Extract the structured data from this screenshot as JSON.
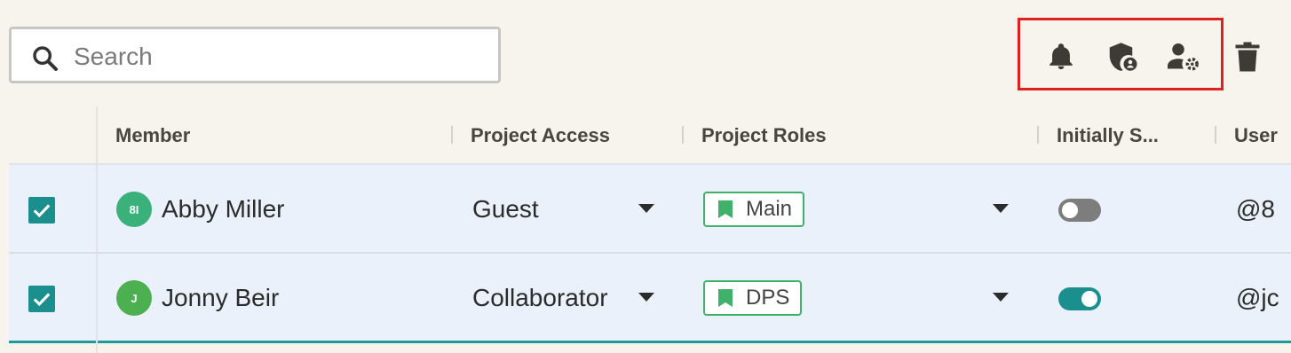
{
  "search": {
    "placeholder": "Search",
    "value": ""
  },
  "toolbar": {
    "icons": [
      "bell-icon",
      "shield-account-icon",
      "user-settings-icon",
      "trash-icon"
    ]
  },
  "table": {
    "headers": {
      "member": "Member",
      "project_access": "Project Access",
      "project_roles": "Project Roles",
      "initially_selected": "Initially S...",
      "user": "User"
    },
    "rows": [
      {
        "checked": true,
        "avatar_initials": "8I",
        "avatar_color": "#3ab07a",
        "name": "Abby Miller",
        "access": "Guest",
        "role": "Main",
        "toggle_on": false,
        "username": "@8"
      },
      {
        "checked": true,
        "avatar_initials": "J",
        "avatar_color": "#4cb050",
        "name": "Jonny Beir",
        "access": "Collaborator",
        "role": "DPS",
        "toggle_on": true,
        "username": "@jc"
      }
    ]
  },
  "colors": {
    "accent": "#1b8f8d",
    "role_border": "#3fb16a",
    "highlight": "#e02020",
    "toggle_off": "#7d7d7d"
  }
}
